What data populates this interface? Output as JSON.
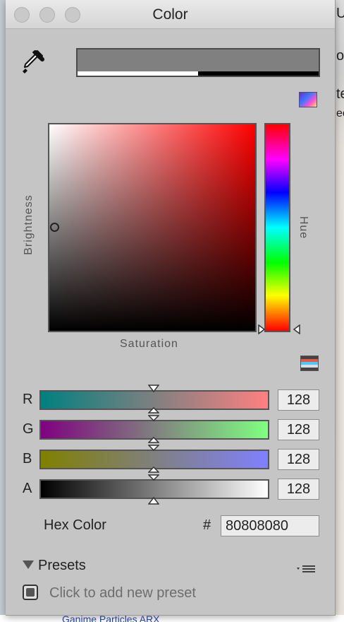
{
  "window": {
    "title": "Color"
  },
  "background": {
    "right_texts": [
      "U",
      "ot",
      "te",
      "ec"
    ],
    "bottom_text": "Ganime Particles ARX"
  },
  "color_picker": {
    "labels": {
      "brightness": "Brightness",
      "saturation": "Saturation",
      "hue": "Hue"
    },
    "channels": [
      {
        "label": "R",
        "value": "128"
      },
      {
        "label": "G",
        "value": "128"
      },
      {
        "label": "B",
        "value": "128"
      },
      {
        "label": "A",
        "value": "128"
      }
    ],
    "hex": {
      "label": "Hex Color",
      "prefix": "#",
      "value": "80808080"
    },
    "current_color": "#808080",
    "alpha_fraction": 0.5
  },
  "presets": {
    "label": "Presets",
    "add_hint": "Click to add new preset"
  },
  "icons": {
    "eyedropper": "eyedropper-icon",
    "color_wheel_toggle": "color-mode-icon",
    "slider_mode": "slider-mode-icon",
    "preset_menu": "preset-menu-icon"
  }
}
